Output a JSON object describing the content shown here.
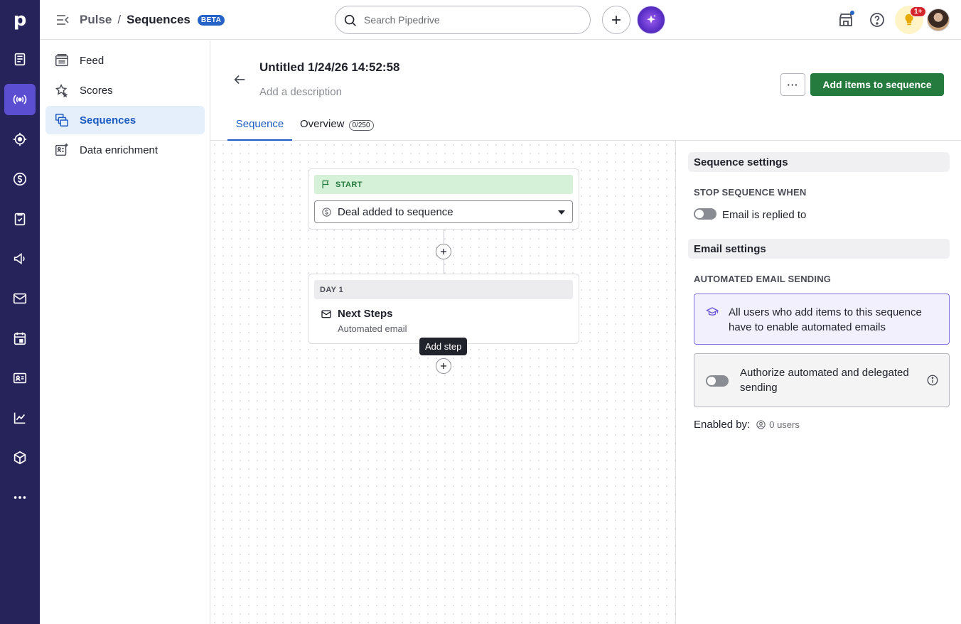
{
  "app": {
    "logo": "p",
    "breadcrumb": {
      "parent": "Pulse",
      "separator": "/",
      "current": "Sequences",
      "badge": "BETA"
    },
    "search_placeholder": "Search Pipedrive",
    "notification_badge": "1+"
  },
  "rail": {
    "items": [
      {
        "icon": "leads-icon"
      },
      {
        "icon": "pulse-icon",
        "active": true
      },
      {
        "icon": "target-icon"
      },
      {
        "icon": "deals-icon"
      },
      {
        "icon": "activities-icon"
      },
      {
        "icon": "campaigns-icon"
      },
      {
        "icon": "mail-icon"
      },
      {
        "icon": "calendar-icon"
      },
      {
        "icon": "contacts-icon"
      },
      {
        "icon": "insights-icon"
      },
      {
        "icon": "products-icon"
      },
      {
        "icon": "more-icon"
      }
    ]
  },
  "subnav": {
    "items": [
      {
        "label": "Feed",
        "icon": "feed-icon"
      },
      {
        "label": "Scores",
        "icon": "stars-icon"
      },
      {
        "label": "Sequences",
        "icon": "sequences-icon",
        "active": true
      },
      {
        "label": "Data enrichment",
        "icon": "enrichment-icon"
      }
    ]
  },
  "sequence": {
    "title": "Untitled 1/24/26 14:52:58",
    "description_placeholder": "Add a description",
    "more_label": "···",
    "primary_action": "Add items to sequence",
    "tabs": [
      {
        "label": "Sequence",
        "active": true
      },
      {
        "label": "Overview",
        "count": "0/250"
      }
    ]
  },
  "canvas": {
    "start": {
      "label": "START",
      "trigger": "Deal added to sequence"
    },
    "steps": [
      {
        "day": "DAY 1",
        "title": "Next Steps",
        "subtitle": "Automated email"
      }
    ],
    "tooltip": "Add step"
  },
  "panel": {
    "sequence_settings_title": "Sequence settings",
    "stop_label": "STOP SEQUENCE WHEN",
    "stop_toggle_label": "Email is replied to",
    "email_settings_title": "Email settings",
    "automated_label": "AUTOMATED EMAIL SENDING",
    "info_text": "All users who add items to this sequence have to enable automated emails",
    "authorize_text": "Authorize automated and delegated sending",
    "enabled_by_label": "Enabled by:",
    "enabled_count": "0 users"
  },
  "colors": {
    "rail_bg": "#26235a",
    "rail_active": "#5b4ed1",
    "accent_blue": "#1b5cc2",
    "primary_green": "#257a3e",
    "start_green_bg": "#d5f1d8",
    "info_purple": "#7f6ee0"
  }
}
